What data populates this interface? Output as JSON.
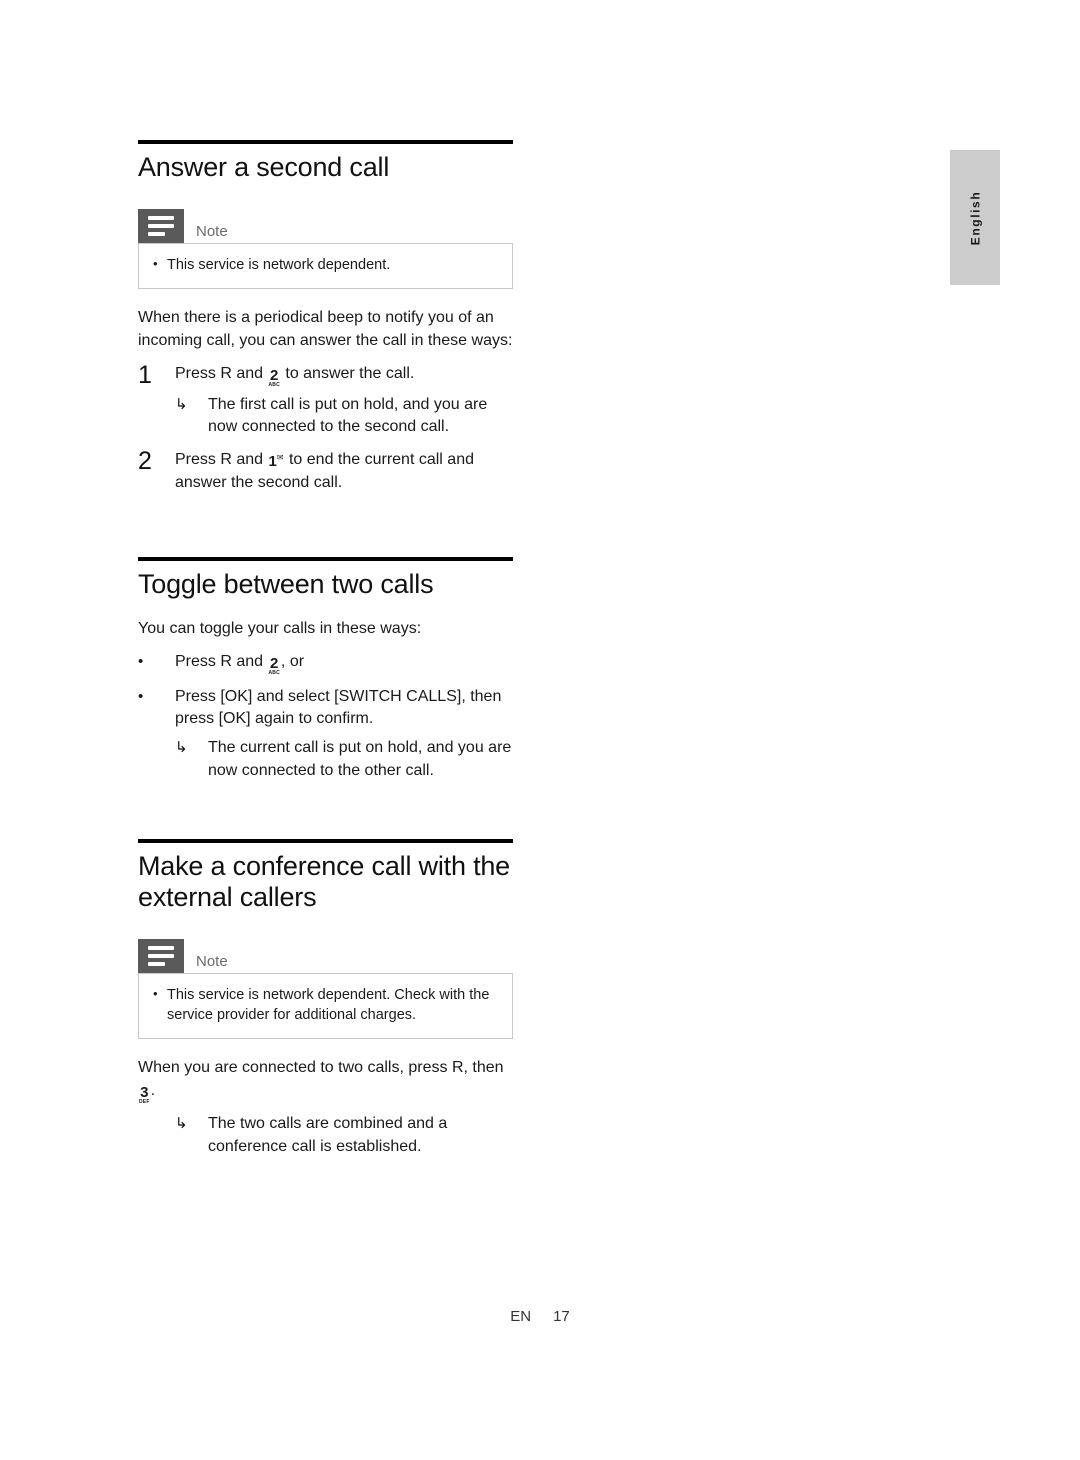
{
  "page": {
    "language_tab": "English",
    "footer": {
      "language_code": "EN",
      "page_number": "17"
    },
    "note_label": "Note",
    "colors": {
      "note_icon_bg": "#5a5a5a",
      "note_border": "#c9c9c9",
      "lang_tab_bg": "#cccccc",
      "rule": "#000000",
      "text": "#1a1a1a"
    }
  },
  "sections": [
    {
      "title": "Answer a second call",
      "note": {
        "label": "Note",
        "items": [
          "This service is network dependent."
        ]
      },
      "intro": "When there is a periodical beep to notify you of an incoming call, you can answer the call in these ways:",
      "steps": [
        {
          "number": "1",
          "text_before": "Press R and ",
          "key": {
            "main": "2",
            "sub": "ABC"
          },
          "text_after": " to answer the call.",
          "results": [
            "The first call is put on hold, and you are now connected to the second call."
          ]
        },
        {
          "number": "2",
          "text_before": "Press R and ",
          "key": {
            "main": "1",
            "superscript": "voicemail-envelope-icon"
          },
          "text_after": " to end the current call and answer the second call.",
          "results": []
        }
      ]
    },
    {
      "title": "Toggle between two calls",
      "note": null,
      "intro": "You can toggle your calls in these ways:",
      "bullets": [
        {
          "text_before": "Press R and ",
          "key": {
            "main": "2",
            "sub": "ABC"
          },
          "text_after": ", or",
          "results": []
        },
        {
          "text_before": "Press [OK] and select [SWITCH CALLS], then press [OK] again to confirm.",
          "key": null,
          "text_after": "",
          "results": [
            "The current call is put on hold, and you are now connected to the other call."
          ]
        }
      ]
    },
    {
      "title": "Make a conference call with the external callers",
      "note": {
        "label": "Note",
        "items": [
          "This service is network dependent. Check with the service provider for additional charges."
        ]
      },
      "intro_before": "When you are connected to two calls, press R, then ",
      "intro_key": {
        "main": "3",
        "sub": "DEF"
      },
      "intro_after": ".",
      "results": [
        "The two calls are combined and a conference call is established."
      ]
    }
  ]
}
